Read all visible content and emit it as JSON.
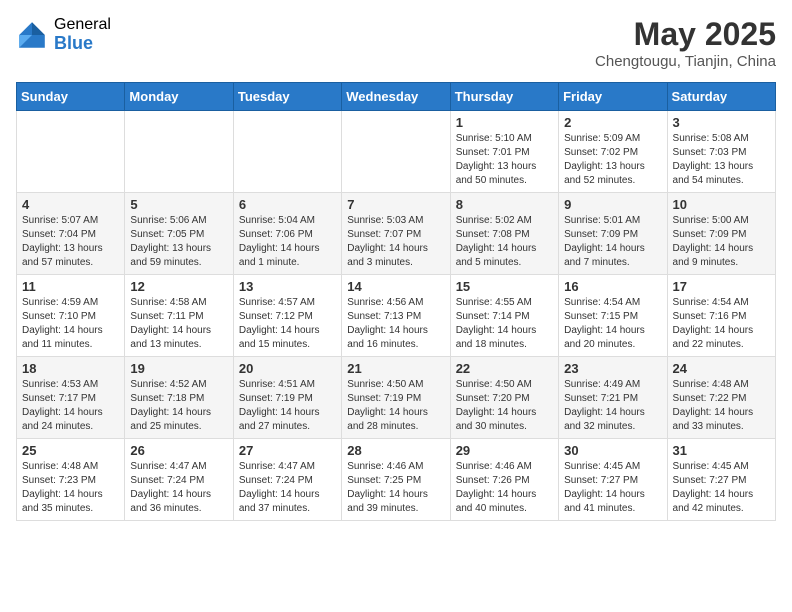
{
  "header": {
    "logo_general": "General",
    "logo_blue": "Blue",
    "title": "May 2025",
    "subtitle": "Chengtougu, Tianjin, China"
  },
  "weekdays": [
    "Sunday",
    "Monday",
    "Tuesday",
    "Wednesday",
    "Thursday",
    "Friday",
    "Saturday"
  ],
  "weeks": [
    [
      {
        "day": "",
        "info": ""
      },
      {
        "day": "",
        "info": ""
      },
      {
        "day": "",
        "info": ""
      },
      {
        "day": "",
        "info": ""
      },
      {
        "day": "1",
        "info": "Sunrise: 5:10 AM\nSunset: 7:01 PM\nDaylight: 13 hours\nand 50 minutes."
      },
      {
        "day": "2",
        "info": "Sunrise: 5:09 AM\nSunset: 7:02 PM\nDaylight: 13 hours\nand 52 minutes."
      },
      {
        "day": "3",
        "info": "Sunrise: 5:08 AM\nSunset: 7:03 PM\nDaylight: 13 hours\nand 54 minutes."
      }
    ],
    [
      {
        "day": "4",
        "info": "Sunrise: 5:07 AM\nSunset: 7:04 PM\nDaylight: 13 hours\nand 57 minutes."
      },
      {
        "day": "5",
        "info": "Sunrise: 5:06 AM\nSunset: 7:05 PM\nDaylight: 13 hours\nand 59 minutes."
      },
      {
        "day": "6",
        "info": "Sunrise: 5:04 AM\nSunset: 7:06 PM\nDaylight: 14 hours\nand 1 minute."
      },
      {
        "day": "7",
        "info": "Sunrise: 5:03 AM\nSunset: 7:07 PM\nDaylight: 14 hours\nand 3 minutes."
      },
      {
        "day": "8",
        "info": "Sunrise: 5:02 AM\nSunset: 7:08 PM\nDaylight: 14 hours\nand 5 minutes."
      },
      {
        "day": "9",
        "info": "Sunrise: 5:01 AM\nSunset: 7:09 PM\nDaylight: 14 hours\nand 7 minutes."
      },
      {
        "day": "10",
        "info": "Sunrise: 5:00 AM\nSunset: 7:09 PM\nDaylight: 14 hours\nand 9 minutes."
      }
    ],
    [
      {
        "day": "11",
        "info": "Sunrise: 4:59 AM\nSunset: 7:10 PM\nDaylight: 14 hours\nand 11 minutes."
      },
      {
        "day": "12",
        "info": "Sunrise: 4:58 AM\nSunset: 7:11 PM\nDaylight: 14 hours\nand 13 minutes."
      },
      {
        "day": "13",
        "info": "Sunrise: 4:57 AM\nSunset: 7:12 PM\nDaylight: 14 hours\nand 15 minutes."
      },
      {
        "day": "14",
        "info": "Sunrise: 4:56 AM\nSunset: 7:13 PM\nDaylight: 14 hours\nand 16 minutes."
      },
      {
        "day": "15",
        "info": "Sunrise: 4:55 AM\nSunset: 7:14 PM\nDaylight: 14 hours\nand 18 minutes."
      },
      {
        "day": "16",
        "info": "Sunrise: 4:54 AM\nSunset: 7:15 PM\nDaylight: 14 hours\nand 20 minutes."
      },
      {
        "day": "17",
        "info": "Sunrise: 4:54 AM\nSunset: 7:16 PM\nDaylight: 14 hours\nand 22 minutes."
      }
    ],
    [
      {
        "day": "18",
        "info": "Sunrise: 4:53 AM\nSunset: 7:17 PM\nDaylight: 14 hours\nand 24 minutes."
      },
      {
        "day": "19",
        "info": "Sunrise: 4:52 AM\nSunset: 7:18 PM\nDaylight: 14 hours\nand 25 minutes."
      },
      {
        "day": "20",
        "info": "Sunrise: 4:51 AM\nSunset: 7:19 PM\nDaylight: 14 hours\nand 27 minutes."
      },
      {
        "day": "21",
        "info": "Sunrise: 4:50 AM\nSunset: 7:19 PM\nDaylight: 14 hours\nand 28 minutes."
      },
      {
        "day": "22",
        "info": "Sunrise: 4:50 AM\nSunset: 7:20 PM\nDaylight: 14 hours\nand 30 minutes."
      },
      {
        "day": "23",
        "info": "Sunrise: 4:49 AM\nSunset: 7:21 PM\nDaylight: 14 hours\nand 32 minutes."
      },
      {
        "day": "24",
        "info": "Sunrise: 4:48 AM\nSunset: 7:22 PM\nDaylight: 14 hours\nand 33 minutes."
      }
    ],
    [
      {
        "day": "25",
        "info": "Sunrise: 4:48 AM\nSunset: 7:23 PM\nDaylight: 14 hours\nand 35 minutes."
      },
      {
        "day": "26",
        "info": "Sunrise: 4:47 AM\nSunset: 7:24 PM\nDaylight: 14 hours\nand 36 minutes."
      },
      {
        "day": "27",
        "info": "Sunrise: 4:47 AM\nSunset: 7:24 PM\nDaylight: 14 hours\nand 37 minutes."
      },
      {
        "day": "28",
        "info": "Sunrise: 4:46 AM\nSunset: 7:25 PM\nDaylight: 14 hours\nand 39 minutes."
      },
      {
        "day": "29",
        "info": "Sunrise: 4:46 AM\nSunset: 7:26 PM\nDaylight: 14 hours\nand 40 minutes."
      },
      {
        "day": "30",
        "info": "Sunrise: 4:45 AM\nSunset: 7:27 PM\nDaylight: 14 hours\nand 41 minutes."
      },
      {
        "day": "31",
        "info": "Sunrise: 4:45 AM\nSunset: 7:27 PM\nDaylight: 14 hours\nand 42 minutes."
      }
    ]
  ]
}
